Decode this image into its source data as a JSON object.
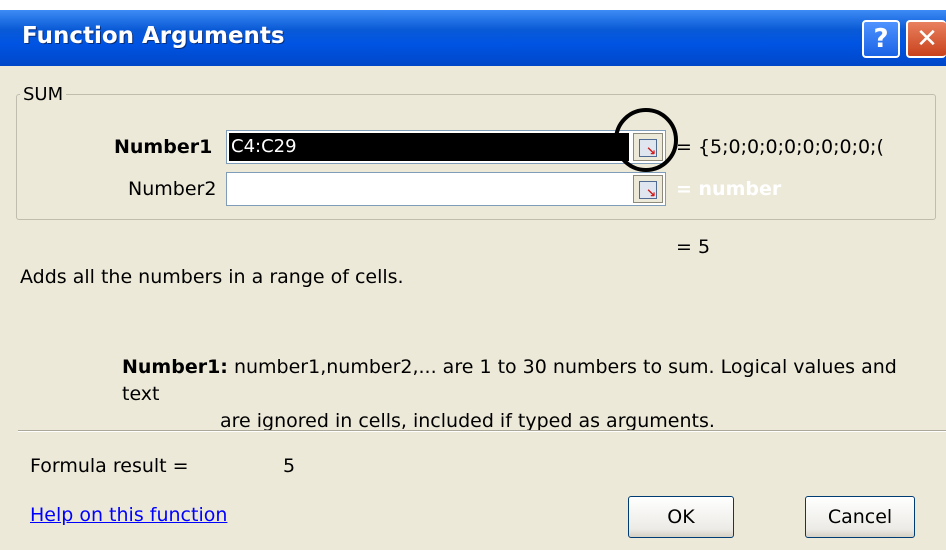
{
  "window": {
    "title": "Function Arguments",
    "help_glyph": "?",
    "close_glyph": "✕",
    "titlebar_color": "#0054e3"
  },
  "function": {
    "name": "SUM"
  },
  "args": [
    {
      "label": "Number1",
      "value": "C4:C29",
      "result": "= {5;0;0;0;0;0;0;0;0;(",
      "selected": true
    },
    {
      "label": "Number2",
      "value": "",
      "result": "= number",
      "selected": false
    }
  ],
  "result_line": "= 5",
  "description": "Adds all the numbers in a range of cells.",
  "arg_help": {
    "name": "Number1:",
    "line1": "number1,number2,... are 1 to 30 numbers to sum. Logical values and text",
    "line2": "are ignored in cells, included if typed as arguments."
  },
  "formula_result": {
    "label": "Formula result =",
    "value": "5"
  },
  "help_link": "Help on this function",
  "buttons": {
    "ok": "OK",
    "cancel": "Cancel"
  },
  "icons": {
    "collapse": "collapse-dialog-icon"
  }
}
